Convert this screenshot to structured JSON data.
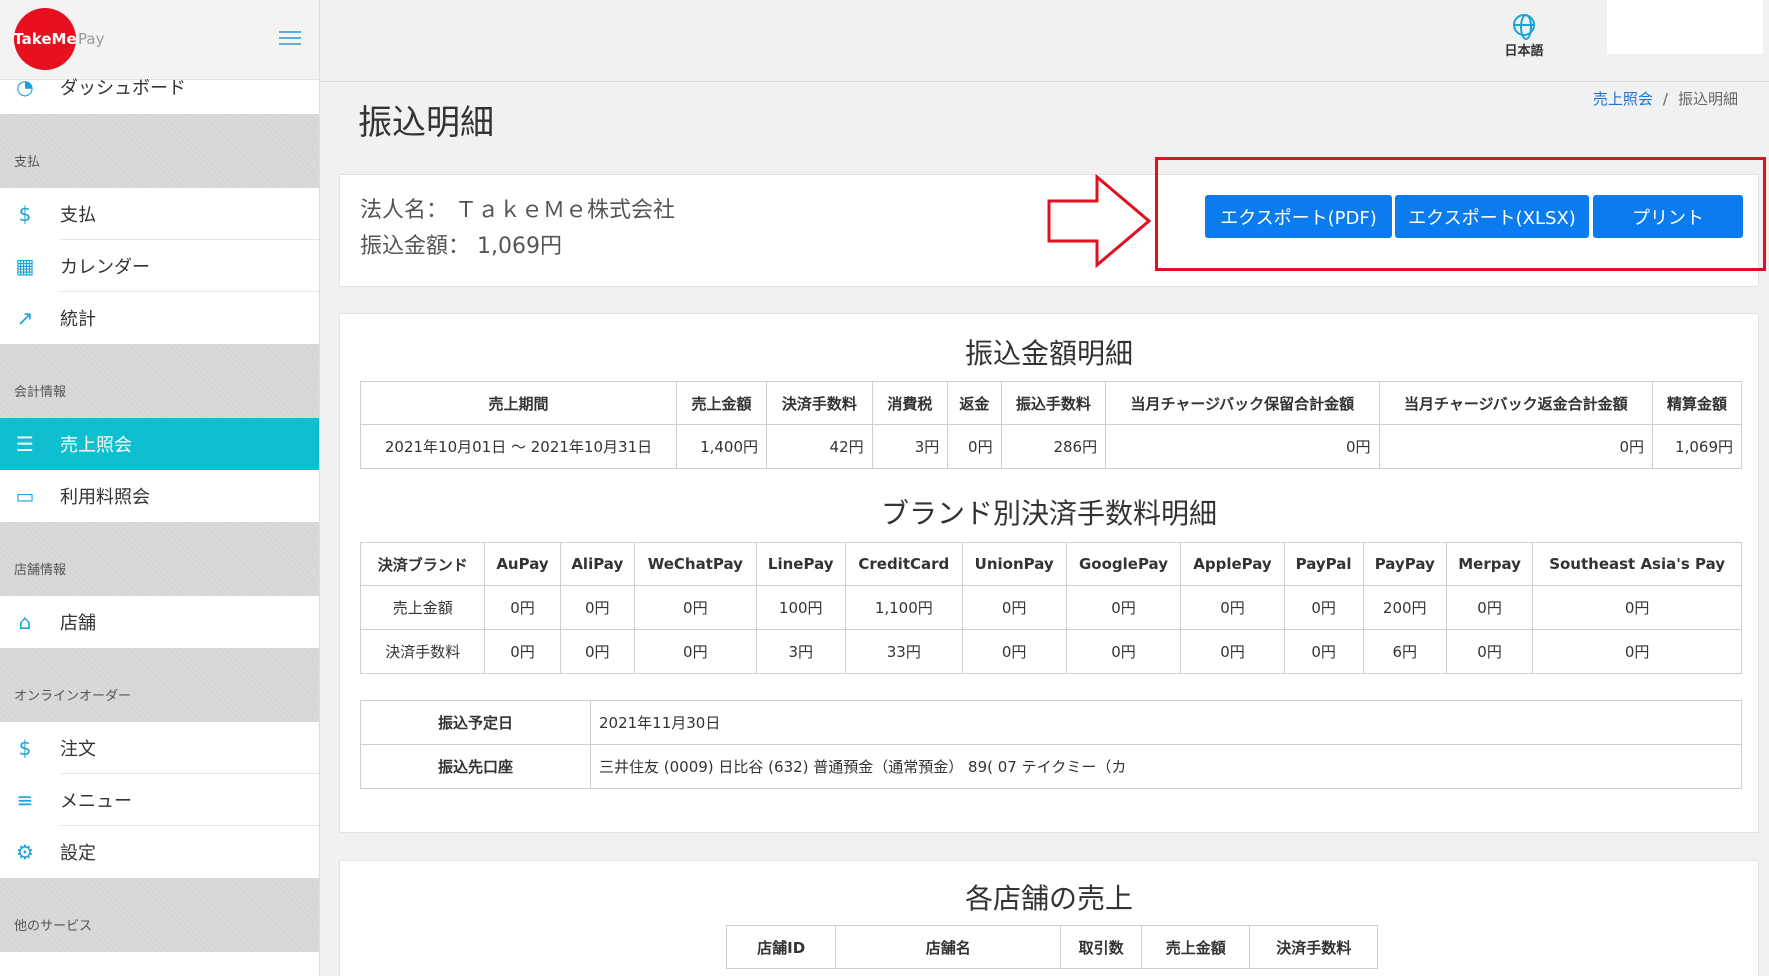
{
  "logo": {
    "text": "TakeMe",
    "suffix": "Pay"
  },
  "sidebar": {
    "top_item": "ダッシュボード",
    "sections": [
      {
        "title": "支払",
        "items": [
          "支払",
          "カレンダー",
          "統計"
        ]
      },
      {
        "title": "会計情報",
        "items": [
          "売上照会",
          "利用料照会"
        ]
      },
      {
        "title": "店舗情報",
        "items": [
          "店舗"
        ]
      },
      {
        "title": "オンラインオーダー",
        "items": [
          "注文",
          "メニュー",
          "設定"
        ]
      },
      {
        "title": "他のサービス",
        "items": []
      }
    ],
    "active_item": "売上照会"
  },
  "header": {
    "language": "日本語"
  },
  "page": {
    "title": "振込明細",
    "breadcrumb": {
      "parent": "売上照会",
      "separator": "/",
      "current": "振込明細"
    }
  },
  "summary": {
    "corp_label": "法人名：",
    "corp_name": "ＴａｋｅＭｅ株式会社",
    "amount_label": "振込金額：",
    "amount": "1,069円",
    "buttons": {
      "pdf": "エクスポート(PDF)",
      "xlsx": "エクスポート(XLSX)",
      "print": "プリント"
    }
  },
  "transfer_detail": {
    "title": "振込金額明細",
    "headers": [
      "売上期間",
      "売上金額",
      "決済手数料",
      "消費税",
      "返金",
      "振込手数料",
      "当月チャージバック保留合計金額",
      "当月チャージバック返金合計金額",
      "精算金額"
    ],
    "row": [
      "2021年10月01日 ～ 2021年10月31日",
      "1,400円",
      "42円",
      "3円",
      "0円",
      "286円",
      "0円",
      "0円",
      "1,069円"
    ]
  },
  "brand_fees": {
    "title": "ブランド別決済手数料明細",
    "headers": [
      "決済ブランド",
      "AuPay",
      "AliPay",
      "WeChatPay",
      "LinePay",
      "CreditCard",
      "UnionPay",
      "GooglePay",
      "ApplePay",
      "PayPal",
      "PayPay",
      "Merpay",
      "Southeast Asia's Pay"
    ],
    "rows": [
      [
        "売上金額",
        "0円",
        "0円",
        "0円",
        "100円",
        "1,100円",
        "0円",
        "0円",
        "0円",
        "0円",
        "200円",
        "0円",
        "0円"
      ],
      [
        "決済手数料",
        "0円",
        "0円",
        "0円",
        "3円",
        "33円",
        "0円",
        "0円",
        "0円",
        "0円",
        "6円",
        "0円",
        "0円"
      ]
    ]
  },
  "transfer_info": {
    "scheduled_label": "振込予定日",
    "scheduled_value": "2021年11月30日",
    "account_label": "振込先口座",
    "account_value": "三井住友 (0009) 日比谷 (632) 普通預金（通常預金） 89(     07 テイクミー（カ"
  },
  "store_sales": {
    "title": "各店舗の売上",
    "headers": [
      "店舗ID",
      "店舗名",
      "取引数",
      "売上金額",
      "決済手数料"
    ]
  },
  "colors": {
    "accent": "#10bfcf",
    "button": "#0a7cf0",
    "highlight": "#e01020",
    "logo": "#e8101f"
  }
}
